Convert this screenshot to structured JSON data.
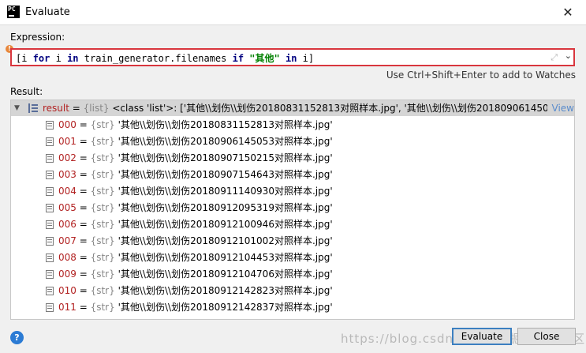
{
  "window": {
    "title": "Evaluate",
    "app_icon_text": "PC",
    "close_glyph": "✕"
  },
  "expression": {
    "label": "Expression:",
    "parts": [
      "[i ",
      "for",
      " i ",
      "in",
      " train_generator.filenames ",
      "if",
      " ",
      "\"其他\"",
      " ",
      "in",
      " i]"
    ],
    "hint": "Use Ctrl+Shift+Enter to add to Watches"
  },
  "result": {
    "label": "Result:",
    "root": {
      "name": "result",
      "eq": " = ",
      "type": "{list}",
      "value": " <class 'list'>: ['其他\\\\划伤\\\\划伤20180831152813对照样本.jpg', '其他\\\\划伤\\\\划伤20180906145053对...",
      "view_link": "View"
    },
    "items": [
      {
        "index": "000",
        "type": "{str}",
        "value": "'其他\\\\划伤\\\\划伤20180831152813对照样本.jpg'"
      },
      {
        "index": "001",
        "type": "{str}",
        "value": "'其他\\\\划伤\\\\划伤20180906145053对照样本.jpg'"
      },
      {
        "index": "002",
        "type": "{str}",
        "value": "'其他\\\\划伤\\\\划伤20180907150215对照样本.jpg'"
      },
      {
        "index": "003",
        "type": "{str}",
        "value": "'其他\\\\划伤\\\\划伤20180907154643对照样本.jpg'"
      },
      {
        "index": "004",
        "type": "{str}",
        "value": "'其他\\\\划伤\\\\划伤20180911140930对照样本.jpg'"
      },
      {
        "index": "005",
        "type": "{str}",
        "value": "'其他\\\\划伤\\\\划伤20180912095319对照样本.jpg'"
      },
      {
        "index": "006",
        "type": "{str}",
        "value": "'其他\\\\划伤\\\\划伤20180912100946对照样本.jpg'"
      },
      {
        "index": "007",
        "type": "{str}",
        "value": "'其他\\\\划伤\\\\划伤20180912101002对照样本.jpg'"
      },
      {
        "index": "008",
        "type": "{str}",
        "value": "'其他\\\\划伤\\\\划伤20180912104453对照样本.jpg'"
      },
      {
        "index": "009",
        "type": "{str}",
        "value": "'其他\\\\划伤\\\\划伤20180912104706对照样本.jpg'"
      },
      {
        "index": "010",
        "type": "{str}",
        "value": "'其他\\\\划伤\\\\划伤20180912142823对照样本.jpg'"
      },
      {
        "index": "011",
        "type": "{str}",
        "value": "'其他\\\\划伤\\\\划伤20180912142837对照样本.jpg'"
      }
    ]
  },
  "buttons": {
    "help": "?",
    "evaluate": "Evaluate",
    "close": "Close"
  },
  "watermark": "https://blog.csdn.net 稀土掘金技术社区",
  "colors": {
    "error_border": "#d9363e",
    "keyword": "#000080",
    "string": "#008000",
    "var_name": "#b22222",
    "link": "#5a8ccc",
    "default_button_border": "#3c7fc0"
  },
  "icons": {
    "app": "pycharm-icon",
    "close": "close-icon",
    "warning": "warning-icon",
    "expand": "expand-icon",
    "dropdown": "chevron-down-icon",
    "list": "list-icon",
    "str": "string-field-icon",
    "help": "help-icon"
  }
}
